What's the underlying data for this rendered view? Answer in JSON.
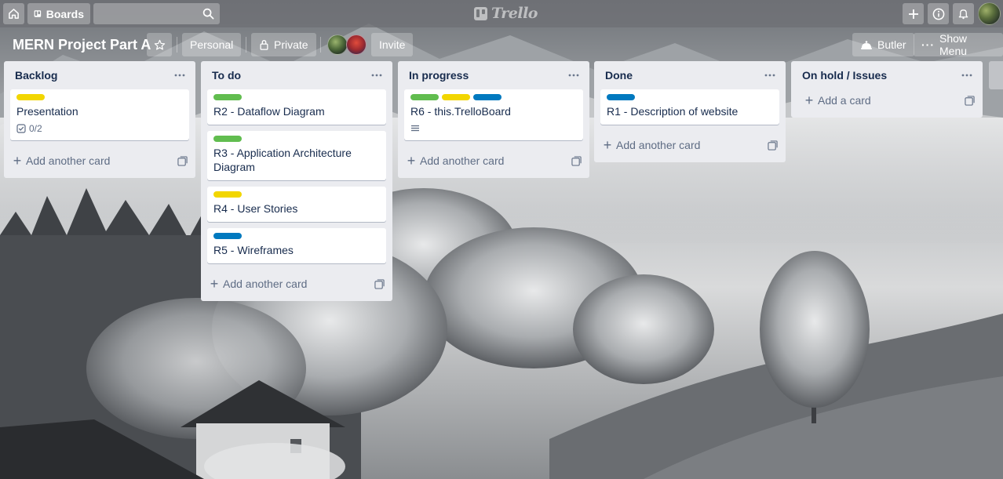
{
  "header": {
    "boards_label": "Boards",
    "search_value": "",
    "logo_text": "Trello"
  },
  "board": {
    "title": "MERN Project Part A",
    "team_label": "Personal",
    "visibility_label": "Private",
    "invite_label": "Invite",
    "butler_label": "Butler",
    "menu_label": "Show Menu"
  },
  "lists": [
    {
      "title": "Backlog",
      "add_label": "Add another card",
      "cards": [
        {
          "title": "Presentation",
          "labels": [
            "#f2d600"
          ],
          "checklist": "0/2",
          "description": false
        }
      ]
    },
    {
      "title": "To do",
      "add_label": "Add another card",
      "cards": [
        {
          "title": "R2 - Dataflow Diagram",
          "labels": [
            "#61bd4f"
          ]
        },
        {
          "title": "R3 - Application Architecture Diagram",
          "labels": [
            "#61bd4f"
          ]
        },
        {
          "title": "R4 - User Stories",
          "labels": [
            "#f2d600"
          ]
        },
        {
          "title": "R5 - Wireframes",
          "labels": [
            "#0079bf"
          ]
        }
      ]
    },
    {
      "title": "In progress",
      "add_label": "Add another card",
      "cards": [
        {
          "title": "R6 - this.TrelloBoard",
          "labels": [
            "#61bd4f",
            "#f2d600",
            "#0079bf"
          ],
          "description": true
        }
      ]
    },
    {
      "title": "Done",
      "add_label": "Add another card",
      "cards": [
        {
          "title": "R1 - Description of website",
          "labels": [
            "#0079bf"
          ]
        }
      ]
    },
    {
      "title": "On hold / Issues",
      "add_label": "Add a card",
      "cards": []
    }
  ],
  "colors": {
    "label_green": "#61bd4f",
    "label_yellow": "#f2d600",
    "label_blue": "#0079bf",
    "list_bg": "#ebecf0"
  }
}
